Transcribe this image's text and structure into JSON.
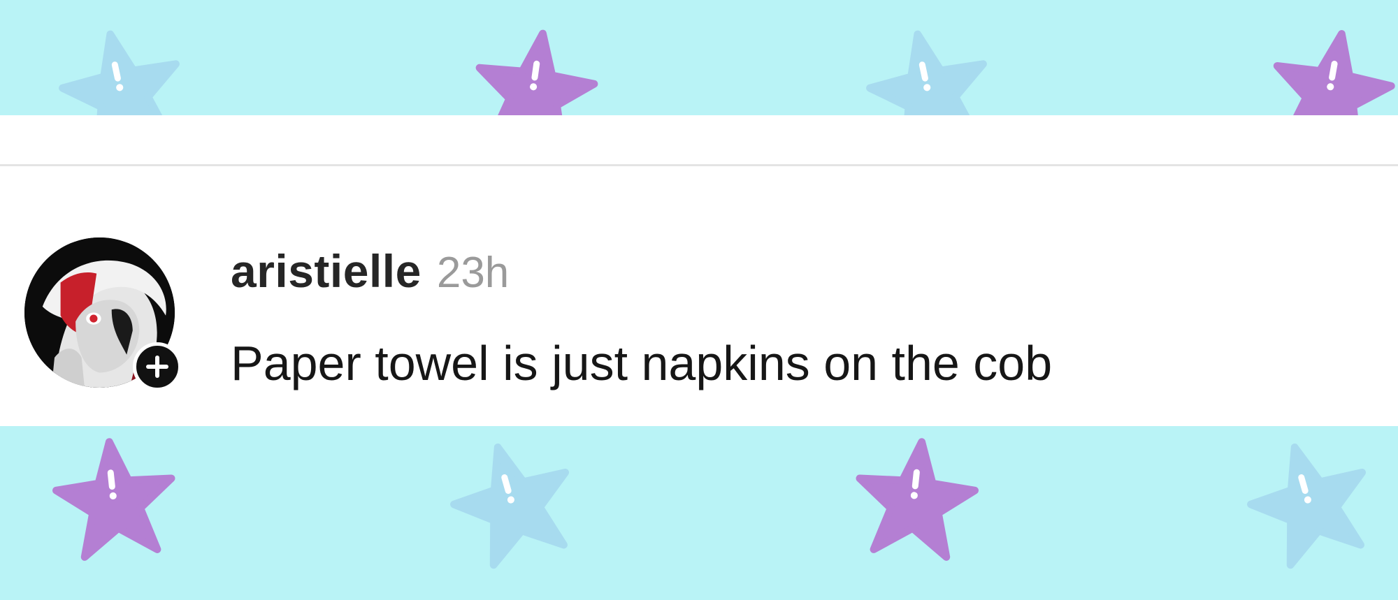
{
  "post": {
    "username": "aristielle",
    "timestamp": "23h",
    "text": "Paper towel is just napkins on the cob"
  },
  "icons": {
    "avatar": "avatar-anime-character",
    "follow": "plus-icon",
    "decoration": "star-icon"
  },
  "colors": {
    "background": "#b9f3f6",
    "star_blue": "#a7dbef",
    "star_purple": "#b47fd3",
    "card": "#ffffff",
    "username": "#262626",
    "timestamp": "#9a9a9a"
  }
}
